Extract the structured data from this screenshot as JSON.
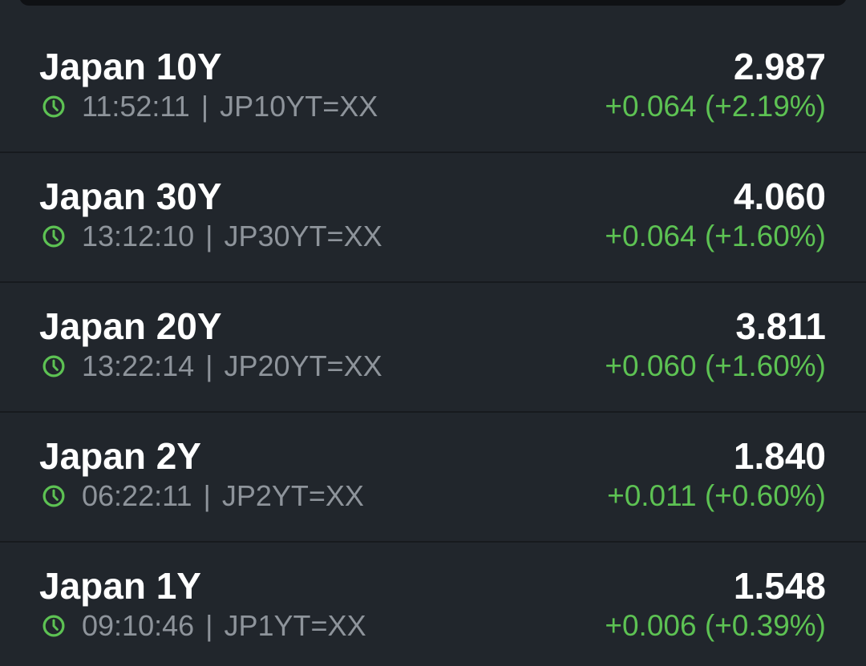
{
  "colors": {
    "background": "#21262c",
    "text_primary": "#ffffff",
    "text_secondary": "#8e949b",
    "positive": "#5dc253"
  },
  "separator": "|",
  "icons": {
    "time": "clock-icon"
  },
  "rows": [
    {
      "name": "Japan 10Y",
      "time": "11:52:11",
      "symbol": "JP10YT=XX",
      "price": "2.987",
      "change": "+0.064 (+2.19%)"
    },
    {
      "name": "Japan 30Y",
      "time": "13:12:10",
      "symbol": "JP30YT=XX",
      "price": "4.060",
      "change": "+0.064 (+1.60%)"
    },
    {
      "name": "Japan 20Y",
      "time": "13:22:14",
      "symbol": "JP20YT=XX",
      "price": "3.811",
      "change": "+0.060 (+1.60%)"
    },
    {
      "name": "Japan 2Y",
      "time": "06:22:11",
      "symbol": "JP2YT=XX",
      "price": "1.840",
      "change": "+0.011 (+0.60%)"
    },
    {
      "name": "Japan 1Y",
      "time": "09:10:46",
      "symbol": "JP1YT=XX",
      "price": "1.548",
      "change": "+0.006 (+0.39%)"
    }
  ]
}
